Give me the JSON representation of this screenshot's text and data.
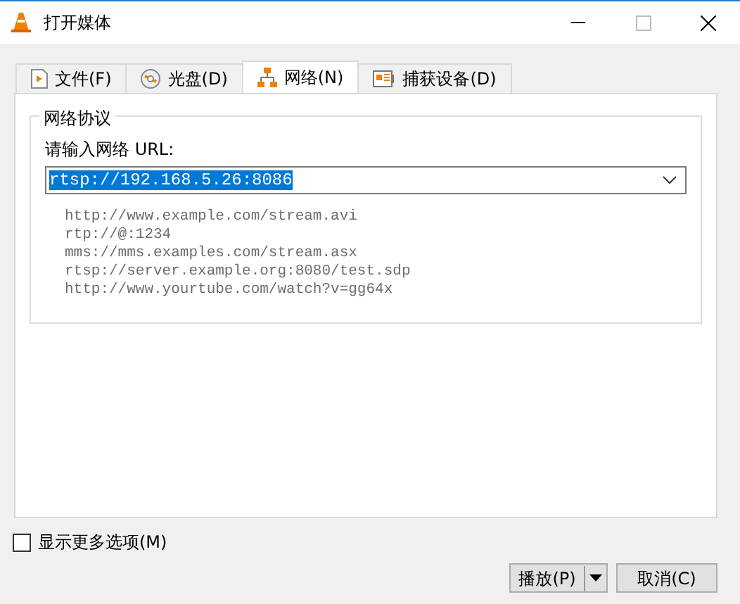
{
  "window": {
    "title": "打开媒体"
  },
  "tabs": [
    {
      "label": "文件(F)",
      "kind": "file",
      "selected": false
    },
    {
      "label": "光盘(D)",
      "kind": "disc",
      "selected": false
    },
    {
      "label": "网络(N)",
      "kind": "network",
      "selected": true
    },
    {
      "label": "捕获设备(D)",
      "kind": "capture",
      "selected": false
    }
  ],
  "network_group": {
    "title": "网络协议",
    "url_label": "请输入网络 URL:",
    "url_value": "rtsp://192.168.5.26:8086",
    "url_selected": true,
    "examples": [
      "http://www.example.com/stream.avi",
      "rtp://@:1234",
      "mms://mms.examples.com/stream.asx",
      "rtsp://server.example.org:8080/test.sdp",
      "http://www.yourtube.com/watch?v=gg64x"
    ]
  },
  "more_options": {
    "label": "显示更多选项(M)",
    "checked": false
  },
  "buttons": [
    {
      "label": "播放(P)",
      "kind": "split"
    },
    {
      "label": "取消(C)",
      "kind": "plain"
    }
  ]
}
